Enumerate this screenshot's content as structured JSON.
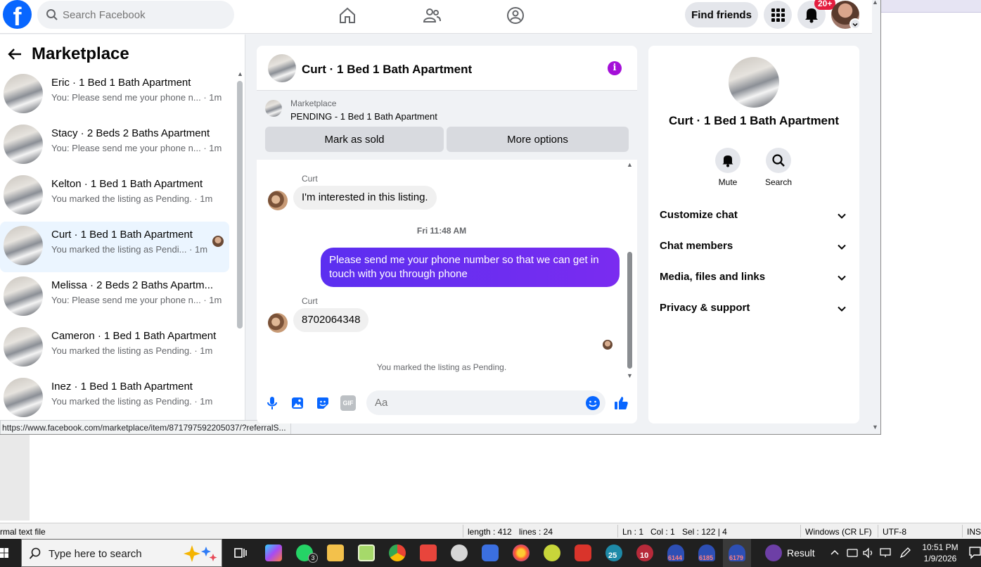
{
  "topbar": {
    "search_placeholder": "Search Facebook",
    "find_friends": "Find friends",
    "notif_badge": "20+"
  },
  "left": {
    "title": "Marketplace",
    "conversations": [
      {
        "title": "Eric · 1 Bed 1 Bath Apartment",
        "snippet": "You: Please send me your phone n... · 1m"
      },
      {
        "title": "Stacy · 2 Beds 2 Baths Apartment",
        "snippet": "You: Please send me your phone n... · 1m"
      },
      {
        "title": "Kelton · 1 Bed 1 Bath Apartment",
        "snippet": "You marked the listing as Pending. · 1m"
      },
      {
        "title": "Curt · 1 Bed 1 Bath Apartment",
        "snippet": "You marked the listing as Pendi... · 1m"
      },
      {
        "title": "Melissa · 2 Beds 2 Baths Apartm...",
        "snippet": "You: Please send me your phone n... · 1m"
      },
      {
        "title": "Cameron · 1 Bed 1 Bath Apartment",
        "snippet": "You marked the listing as Pending. · 1m"
      },
      {
        "title": "Inez · 1 Bed 1 Bath Apartment",
        "snippet": "You marked the listing as Pending. · 1m"
      }
    ],
    "url_status": "https://www.facebook.com/marketplace/item/871797592205037/?referralS..."
  },
  "chat": {
    "title": "Curt · 1 Bed 1 Bath Apartment",
    "banner_label": "Marketplace",
    "banner_status": "PENDING - 1 Bed 1 Bath Apartment",
    "mark_sold": "Mark as sold",
    "more_options": "More options",
    "sender1": "Curt",
    "msg1": "I'm interested in this listing.",
    "time_sep": "Fri 11:48 AM",
    "msg2": "Please send me your phone  number so that we can get in touch with you through phone",
    "sender2": "Curt",
    "msg3": "8702064348",
    "sys_msg": "You marked the listing as Pending.",
    "input_placeholder": "Aa",
    "gif_label": "GIF"
  },
  "right": {
    "title": "Curt · 1 Bed 1 Bath Apartment",
    "mute": "Mute",
    "search": "Search",
    "sections": [
      "Customize chat",
      "Chat members",
      "Media, files and links",
      "Privacy & support"
    ]
  },
  "notepad": {
    "file_type": "rmal text file",
    "length": "length : 412",
    "lines": "lines : 24",
    "ln": "Ln : 1",
    "col": "Col : 1",
    "sel": "Sel : 122 | 4",
    "eol": "Windows (CR LF)",
    "encoding": "UTF-8",
    "ins": "INS"
  },
  "taskbar": {
    "search_text": "Type here to search",
    "whatsapp_count": "3",
    "badge_25": "25",
    "badge_10": "10",
    "badge_6144": "6144",
    "badge_6185": "6185",
    "badge_6179": "6179",
    "result": "Result",
    "time": "10:51 PM",
    "date": "1/9/2026"
  },
  "colors": {
    "fb_blue": "#0866ff",
    "bubble_out": "#5b2ff0",
    "info_purple": "#a40fd8",
    "active_conv_bg": "#ebf5ff"
  }
}
